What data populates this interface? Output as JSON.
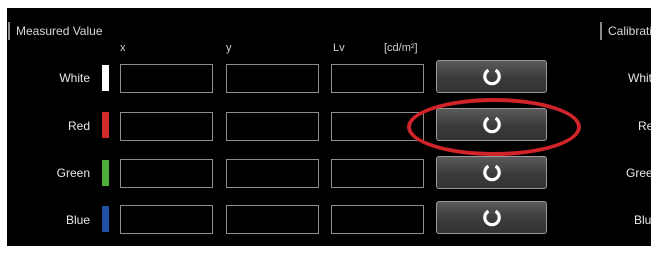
{
  "measured": {
    "title": "Measured Value",
    "columns": {
      "x": "x",
      "y": "y",
      "lv": "Lv",
      "unit": "[cd/m²]"
    },
    "rows": [
      {
        "label": "White",
        "color": "#ffffff",
        "x": "",
        "y": "",
        "lv": ""
      },
      {
        "label": "Red",
        "color": "#d32a2a",
        "x": "",
        "y": "",
        "lv": ""
      },
      {
        "label": "Green",
        "color": "#4caf3a",
        "x": "",
        "y": "",
        "lv": ""
      },
      {
        "label": "Blue",
        "color": "#1e4fa0",
        "x": "",
        "y": "",
        "lv": ""
      }
    ],
    "measure_icon": "measure-start-icon"
  },
  "calibration": {
    "title": "Calibratio",
    "rows": [
      "Whit",
      "Re",
      "Gree",
      "Blu"
    ]
  },
  "annotation": {
    "color": "#d1232a",
    "highlighted_row": "Red"
  }
}
